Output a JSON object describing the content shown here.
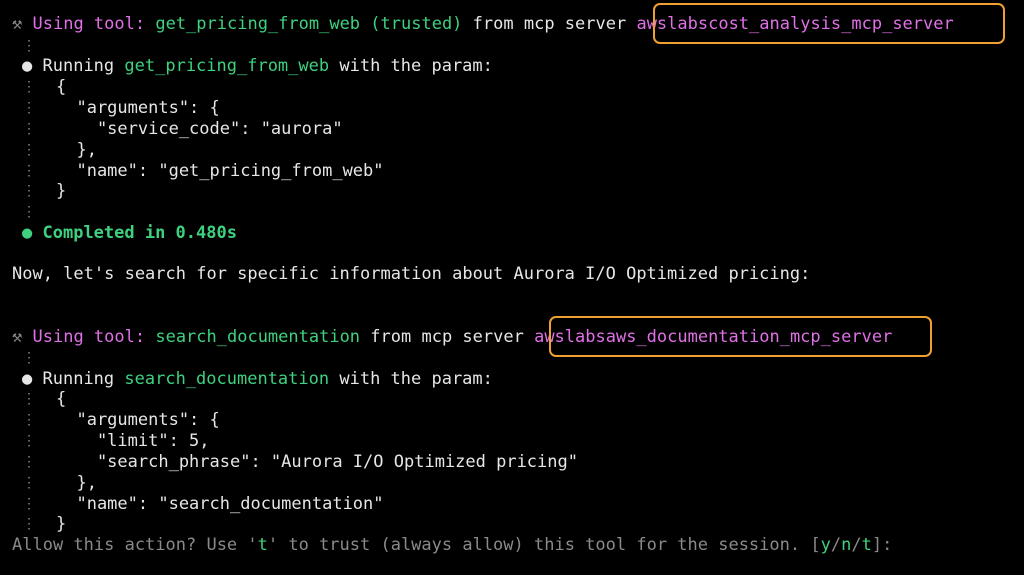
{
  "block1": {
    "icon": "⚒",
    "using_label": "Using tool:",
    "tool_name": "get_pricing_from_web",
    "trusted": "(trusted)",
    "from_text": "from mcp server",
    "server": "awslabscost_analysis_mcp_server",
    "running_prefix": "Running",
    "running_tool": "get_pricing_from_web",
    "running_suffix": "with the param:",
    "json_lines": [
      "{",
      "  \"arguments\": {",
      "    \"service_code\": \"aurora\"",
      "  },",
      "  \"name\": \"get_pricing_from_web\"",
      "}"
    ],
    "completed": "Completed in 0.480s"
  },
  "message": "Now, let's search for specific information about Aurora I/O Optimized pricing:",
  "block2": {
    "icon": "⚒",
    "using_label": "Using tool:",
    "tool_name": "search_documentation",
    "from_text": "from mcp server",
    "server": "awslabsaws_documentation_mcp_server",
    "running_prefix": "Running",
    "running_tool": "search_documentation",
    "running_suffix": "with the param:",
    "json_lines": [
      "{",
      "  \"arguments\": {",
      "    \"limit\": 5,",
      "    \"search_phrase\": \"Aurora I/O Optimized pricing\"",
      "  },",
      "  \"name\": \"search_documentation\"",
      "}"
    ]
  },
  "prompt": {
    "text_before": "Allow this action? Use '",
    "t_key": "t",
    "text_after": "' to trust (always allow) this tool for the session. [",
    "y": "y",
    "sep1": "/",
    "n": "n",
    "sep2": "/",
    "t": "t",
    "end": "]:"
  },
  "colors": {
    "tool": "#3ed17f",
    "server": "#e070e6",
    "highlight": "#f0a030",
    "dim": "#8a8a8a"
  }
}
